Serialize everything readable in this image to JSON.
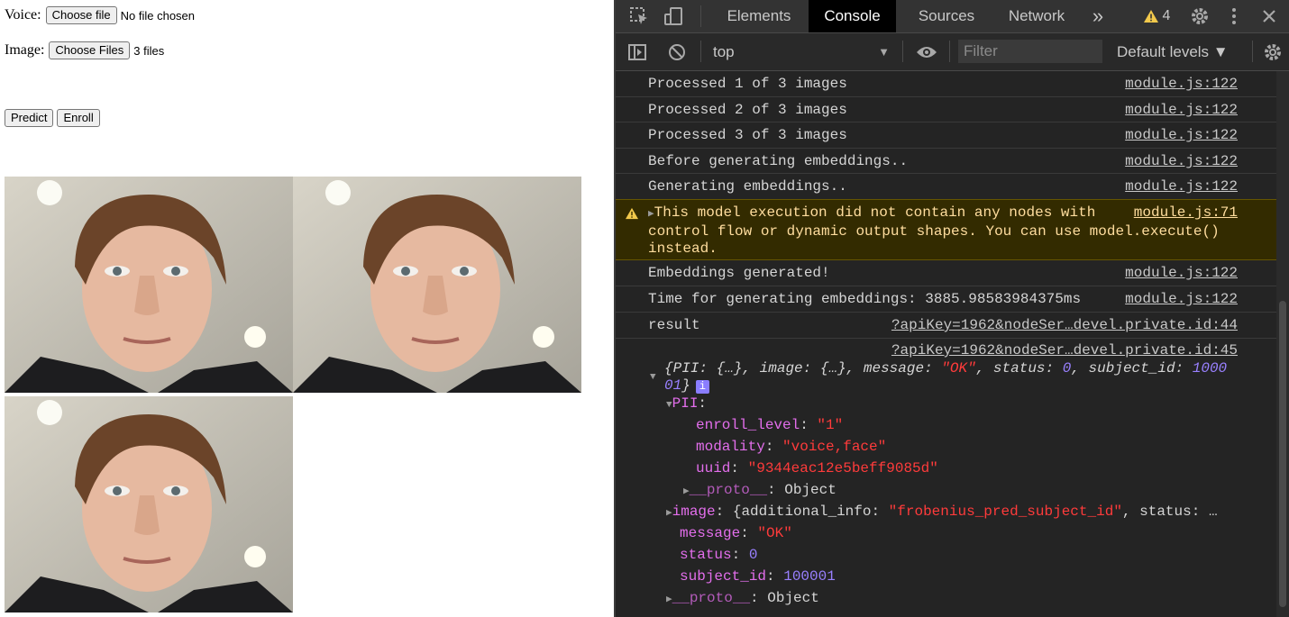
{
  "page": {
    "voice_label": "Voice:",
    "voice_button": "Choose file",
    "voice_status": "No file chosen",
    "image_label": "Image:",
    "image_button": "Choose Files",
    "image_status": "3 files",
    "predict_button": "Predict",
    "enroll_button": "Enroll"
  },
  "devtools": {
    "tabs": [
      "Elements",
      "Console",
      "Sources",
      "Network"
    ],
    "active_tab": "Console",
    "more_tabs": "»",
    "warning_count": "4",
    "context": "top",
    "filter_placeholder": "Filter",
    "levels": "Default levels ▼"
  },
  "console": {
    "messages": [
      {
        "text": "Processed 1 of 3 images",
        "source": "module.js:122"
      },
      {
        "text": "Processed 2 of 3 images",
        "source": "module.js:122"
      },
      {
        "text": "Processed 3 of 3 images",
        "source": "module.js:122"
      },
      {
        "text": "Before generating embeddings..",
        "source": "module.js:122"
      },
      {
        "text": "Generating embeddings..",
        "source": "module.js:122"
      }
    ],
    "warning": {
      "line1": "This model execution did not contain any nodes with",
      "line2": "control flow or dynamic output shapes. You can use model.execute()",
      "line3": "instead.",
      "source": "module.js:71"
    },
    "messages2": [
      {
        "text": "Embeddings generated!",
        "source": "module.js:122"
      },
      {
        "text": "Time for generating embeddings: 3885.98583984375ms",
        "source": "module.js:122"
      }
    ],
    "result": {
      "text": "result",
      "source": "?apiKey=1962&nodeSer…devel.private.id:44"
    },
    "object_source": "?apiKey=1962&nodeSer…devel.private.id:45",
    "object_summary": {
      "pii_key": "PII",
      "pii_val": "{…}",
      "image_key": "image",
      "image_val": "{…}",
      "message_key": "message",
      "message_val": "\"OK\"",
      "status_key": "status",
      "status_val": "0",
      "subject_key": "subject_id",
      "subject_val_a": "1000",
      "subject_val_b": "01"
    },
    "pii": {
      "label": "PII",
      "enroll_key": "enroll_level",
      "enroll_val": "\"1\"",
      "modality_key": "modality",
      "modality_val": "\"voice,face\"",
      "uuid_key": "uuid",
      "uuid_val": "\"9344eac12e5beff9085d\"",
      "proto_key": "__proto__",
      "proto_val": "Object"
    },
    "image_row": {
      "key": "image",
      "prefix": "{additional_info: ",
      "info_val": "\"frobenius_pred_subject_id\"",
      "suffix": ", status: …"
    },
    "fields": {
      "message_key": "message",
      "message_val": "\"OK\"",
      "status_key": "status",
      "status_val": "0",
      "subject_key": "subject_id",
      "subject_val": "100001",
      "proto_key": "__proto__",
      "proto_val": "Object"
    }
  }
}
